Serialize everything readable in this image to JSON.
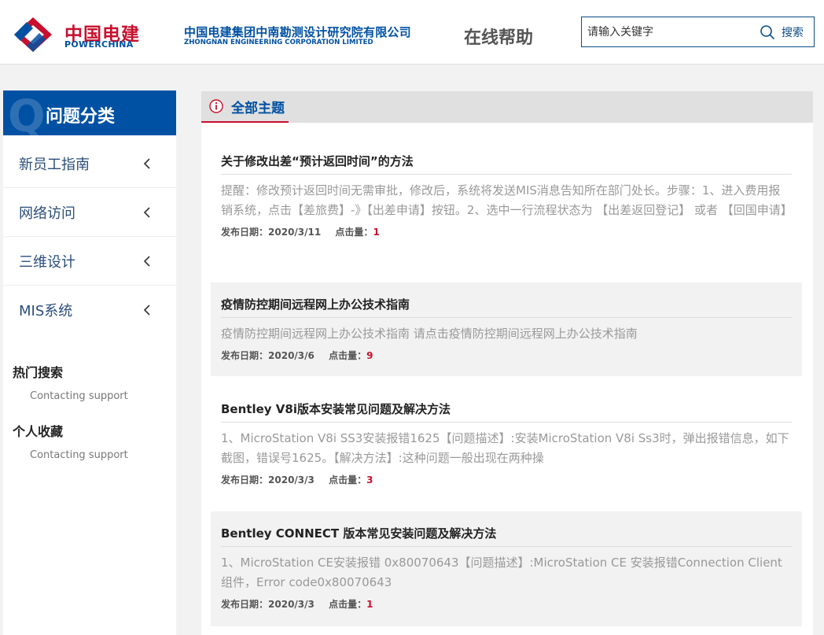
{
  "header": {
    "logo_cn": "中国电建",
    "logo_en": "POWERCHINA",
    "company_cn": "中国电建集团中南勘测设计研究院有限公司",
    "company_en": "ZHONGNAN ENGINEERING CORPORATION LIMITED",
    "site_title": "在线帮助",
    "search_placeholder": "请输入关键字",
    "search_label": "搜索"
  },
  "sidebar": {
    "category_title": "问题分类",
    "category_glyph": "Q",
    "items": [
      {
        "label": "新员工指南"
      },
      {
        "label": "网络访问"
      },
      {
        "label": "三维设计"
      },
      {
        "label": "MIS系统"
      }
    ],
    "hot_search": {
      "title": "热门搜索",
      "link": "Contacting support"
    },
    "favorites": {
      "title": "个人收藏",
      "link": "Contacting support"
    }
  },
  "main": {
    "tab_label": "全部主题",
    "date_label": "发布日期：",
    "hits_label": "点击量：",
    "articles": [
      {
        "title": "关于修改出差“预计返回时间”的方法",
        "summary": "提醒：修改预计返回时间无需审批，修改后，系统将发送MIS消息告知所在部门处长。步骤：1、进入费用报销系统，点击【差旅费】-》【出差申请】按钮。2、选中一行流程状态为 【出差返回登记】 或者 【回国申请】",
        "date": "2020/3/11",
        "hits": "1"
      },
      {
        "title": "疫情防控期间远程网上办公技术指南",
        "summary": "疫情防控期间远程网上办公技术指南 请点击疫情防控期间远程网上办公技术指南",
        "date": "2020/3/6",
        "hits": "9"
      },
      {
        "title": "Bentley V8i版本安装常见问题及解决方法",
        "summary": "1、MicroStation V8i SS3安装报错1625【问题描述】:安装MicroStation V8i Ss3时，弹出报错信息，如下截图，错误号1625。【解决方法】:这种问题一般出现在两种操",
        "date": "2020/3/3",
        "hits": "3"
      },
      {
        "title": "Bentley CONNECT 版本常见安装问题及解决方法",
        "summary": "1、MicroStation CE安装报错 0x80070643【问题描述】:MicroStation CE 安装报错Connection Client 组件，Error code0x80070643",
        "date": "2020/3/3",
        "hits": "1"
      }
    ]
  },
  "colors": {
    "brand_blue": "#0051a3",
    "brand_red": "#c8102e"
  }
}
